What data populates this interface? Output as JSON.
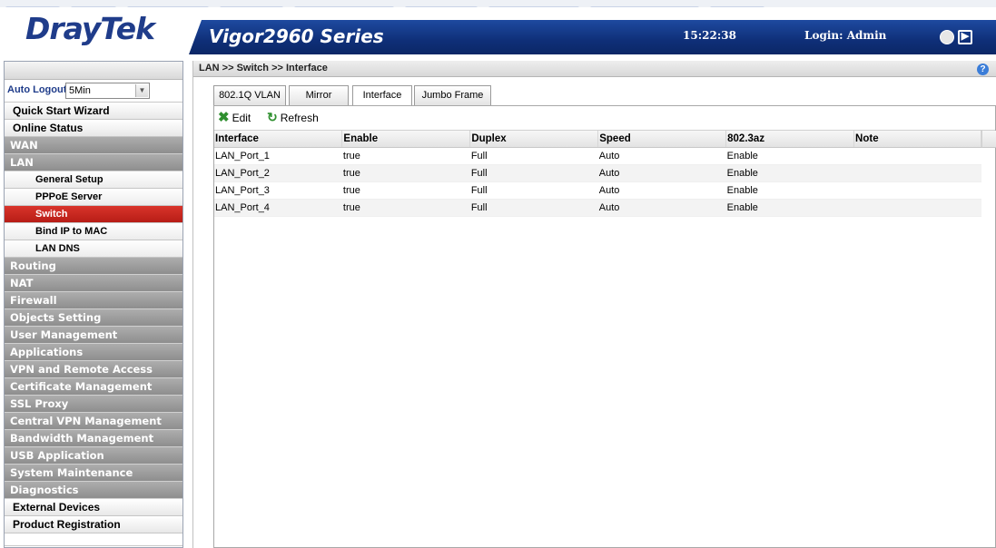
{
  "header": {
    "brand": "DrayTek",
    "series": "Vigor2960 Series",
    "time": "15:22:38",
    "login": "Login: Admin"
  },
  "breadcrumb": "LAN >> Switch >> Interface",
  "sidebar": {
    "auto_logout_label": "Auto Logout :",
    "auto_logout_value": "5Min",
    "items": [
      {
        "label": "Quick Start Wizard",
        "style": "light"
      },
      {
        "label": "Online Status",
        "style": "light"
      },
      {
        "label": "WAN",
        "style": "gray"
      },
      {
        "label": "LAN",
        "style": "gray"
      },
      {
        "label": "General Setup",
        "style": "sub"
      },
      {
        "label": "PPPoE Server",
        "style": "sub"
      },
      {
        "label": "Switch",
        "style": "active"
      },
      {
        "label": "Bind IP to MAC",
        "style": "sub"
      },
      {
        "label": "LAN DNS",
        "style": "sub"
      },
      {
        "label": "Routing",
        "style": "gray"
      },
      {
        "label": "NAT",
        "style": "gray"
      },
      {
        "label": "Firewall",
        "style": "gray"
      },
      {
        "label": "Objects Setting",
        "style": "gray"
      },
      {
        "label": "User Management",
        "style": "gray"
      },
      {
        "label": "Applications",
        "style": "gray"
      },
      {
        "label": "VPN and Remote Access",
        "style": "gray"
      },
      {
        "label": "Certificate Management",
        "style": "gray"
      },
      {
        "label": "SSL Proxy",
        "style": "gray"
      },
      {
        "label": "Central VPN Management",
        "style": "gray"
      },
      {
        "label": "Bandwidth Management",
        "style": "gray"
      },
      {
        "label": "USB Application",
        "style": "gray"
      },
      {
        "label": "System Maintenance",
        "style": "gray"
      },
      {
        "label": "Diagnostics",
        "style": "gray"
      },
      {
        "label": "External Devices",
        "style": "light"
      },
      {
        "label": "Product Registration",
        "style": "light"
      }
    ]
  },
  "tabs": [
    {
      "label": "802.1Q VLAN"
    },
    {
      "label": "Mirror"
    },
    {
      "label": "Interface"
    },
    {
      "label": "Jumbo Frame"
    }
  ],
  "toolbar": {
    "edit_label": "Edit",
    "refresh_label": "Refresh"
  },
  "table": {
    "headers": [
      "Interface",
      "Enable",
      "Duplex",
      "Speed",
      "802.3az",
      "Note"
    ],
    "rows": [
      [
        "LAN_Port_1",
        "true",
        "Full",
        "Auto",
        "Enable",
        ""
      ],
      [
        "LAN_Port_2",
        "true",
        "Full",
        "Auto",
        "Enable",
        ""
      ],
      [
        "LAN_Port_3",
        "true",
        "Full",
        "Auto",
        "Enable",
        ""
      ],
      [
        "LAN_Port_4",
        "true",
        "Full",
        "Auto",
        "Enable",
        ""
      ]
    ]
  },
  "colors": {
    "brand_blue": "#1f3c8a",
    "header_bar": "#0f2f78",
    "active_item": "#c8251d",
    "section_gray": "#9a9a9a"
  }
}
